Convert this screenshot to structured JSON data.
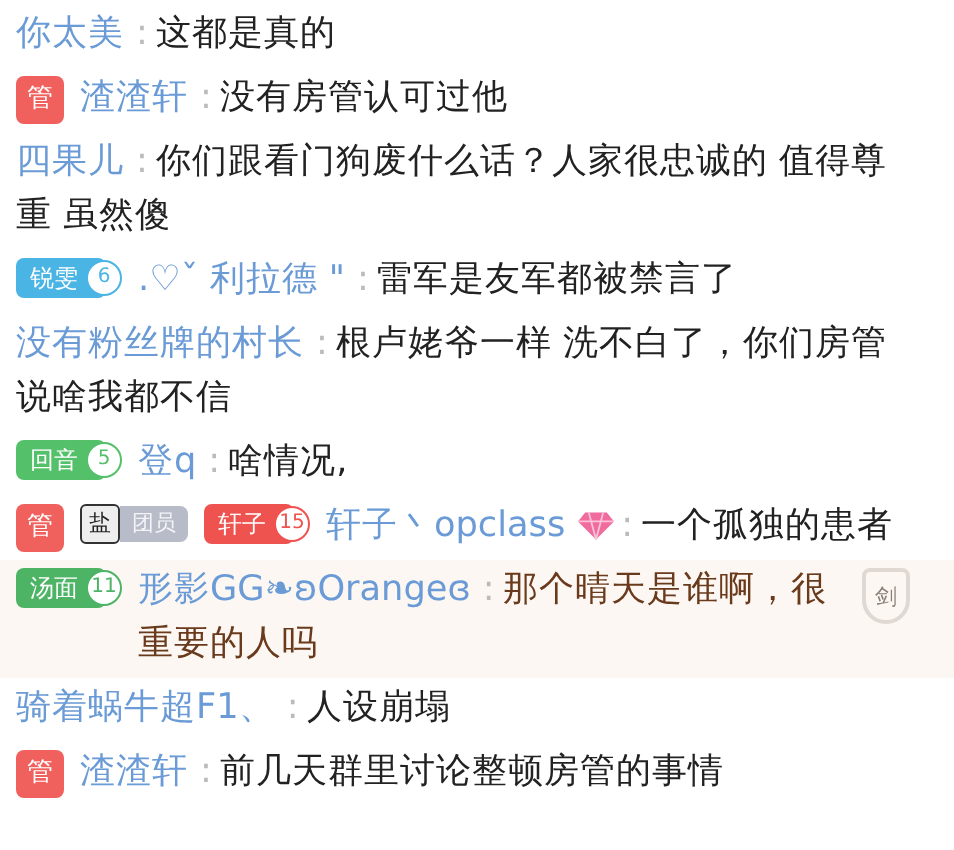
{
  "messages": [
    {
      "name": "你太美",
      "colon": ":",
      "text": "这都是真的",
      "highlighted": false
    },
    {
      "badges": [
        {
          "kind": "admin",
          "label": "管"
        }
      ],
      "name": "渣渣轩",
      "colon": ":",
      "text": "没有房管认可过他",
      "highlighted": false
    },
    {
      "name": "四果儿",
      "colon": ":",
      "text": "你们跟看门狗废什么话？人家很忠诚的 值得尊重 虽然傻",
      "highlighted": false
    },
    {
      "badges": [
        {
          "kind": "medal",
          "label": "锐雯",
          "level": "6",
          "color": "#4ab5e4"
        }
      ],
      "name": ".♡ˇ   利拉德 \"",
      "colon": ":",
      "text": "雷军是友军都被禁言了",
      "highlighted": false
    },
    {
      "name": "没有粉丝牌的村长",
      "colon": ":",
      "text": "根卢姥爷一样 洗不白了，你们房管说啥我都不信",
      "highlighted": false
    },
    {
      "badges": [
        {
          "kind": "medal",
          "label": "回音",
          "level": "5",
          "color": "#55c06a"
        }
      ],
      "name": "登q",
      "colon": ":",
      "text": "啥情况,",
      "highlighted": false
    },
    {
      "badges": [
        {
          "kind": "admin",
          "label": "管"
        },
        {
          "kind": "group",
          "icon_text": "盐",
          "label": "团员"
        },
        {
          "kind": "medal",
          "label": "轩子",
          "level": "15",
          "color": "#ef5350"
        }
      ],
      "name": "轩子丶opclass",
      "gem": true,
      "colon": ":",
      "text": "一个孤独的患者",
      "highlighted": false
    },
    {
      "badges": [
        {
          "kind": "medal",
          "label": "汤面",
          "level": "11",
          "color": "#4cb464"
        }
      ],
      "name": "形影GG❧ʚOrangeɞ",
      "colon": ":",
      "text": "那个晴天是谁啊，很重要的人吗",
      "highlighted": true,
      "shield_text": "剑"
    },
    {
      "name": "骑着蜗牛超F1、",
      "colon": ":",
      "text": "人设崩塌",
      "highlighted": false
    },
    {
      "badges": [
        {
          "kind": "admin",
          "label": "管"
        }
      ],
      "name": "渣渣轩",
      "colon": ":",
      "text": "前几天群里讨论整顿房管的事情",
      "highlighted": false
    }
  ]
}
